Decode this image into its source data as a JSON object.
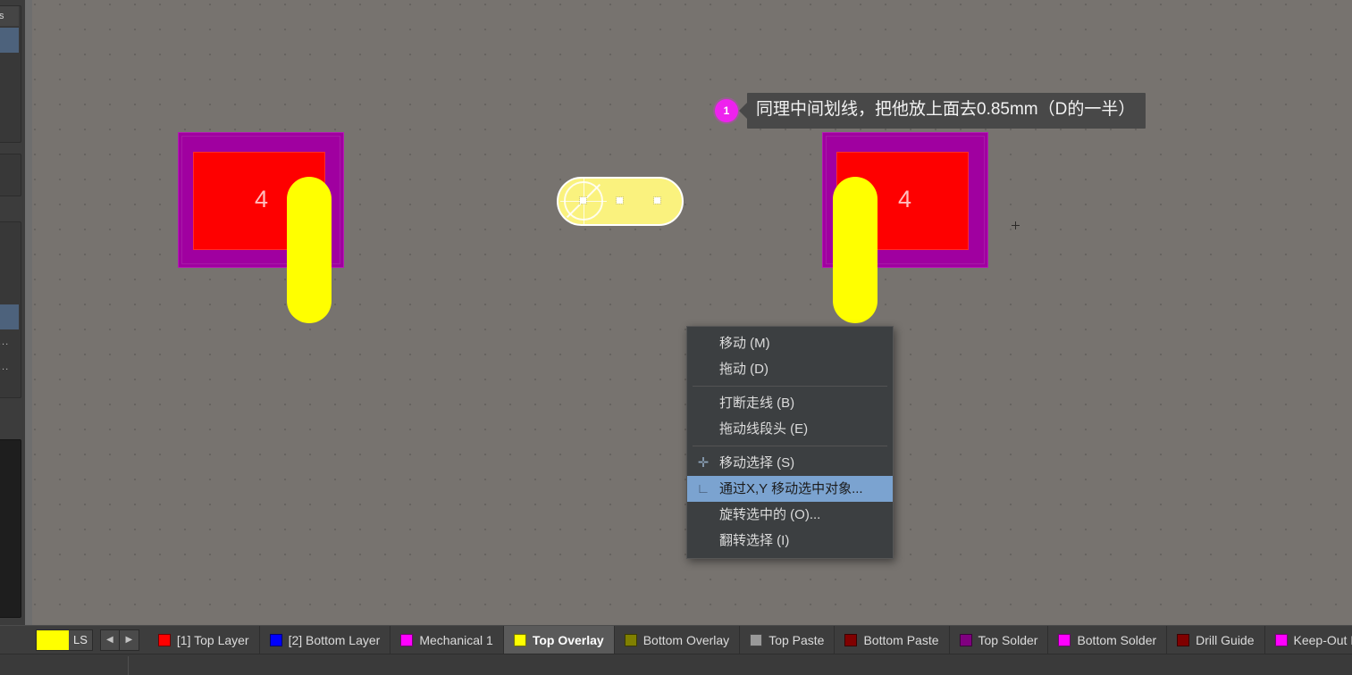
{
  "canvas": {
    "background_color": "#77736f",
    "grid_spacing_px": 28,
    "footprints": [
      {
        "id": "left-footprint",
        "pad_number": "4",
        "mask_color": "#a000a0",
        "pad_color": "#fe0000",
        "silk_color": "#ffff00"
      },
      {
        "id": "right-footprint",
        "pad_number": "4",
        "mask_color": "#a000a0",
        "pad_color": "#fe0000",
        "silk_color": "#ffff00"
      }
    ],
    "selected_track": {
      "name": "selected-overlay-track",
      "fill_color": "#faf27e",
      "outline_color": "#ffffff",
      "handle_count": 3
    }
  },
  "annotation": {
    "badge": "1",
    "badge_color": "#ee22ee",
    "text": "同理中间划线，把他放上面去0.85mm（D的一半）"
  },
  "context_menu": {
    "items": [
      {
        "label": "移动 (M)",
        "icon": "",
        "selected": false,
        "separator_after": true
      },
      {
        "label": "拖动 (D)",
        "icon": "",
        "selected": false,
        "separator_after": true
      },
      {
        "label": "打断走线 (B)",
        "icon": "",
        "selected": false,
        "separator_after": false
      },
      {
        "label": "拖动线段头 (E)",
        "icon": "",
        "selected": false,
        "separator_after": true
      },
      {
        "label": "移动选择 (S)",
        "icon": "plus-icon",
        "selected": false,
        "separator_after": false
      },
      {
        "label": "通过X,Y 移动选中对象...",
        "icon": "axis-icon",
        "selected": true,
        "separator_after": false
      },
      {
        "label": "旋转选中的 (O)...",
        "icon": "",
        "selected": false,
        "separator_after": false
      },
      {
        "label": "翻转选择 (I)",
        "icon": "",
        "selected": false,
        "separator_after": false
      }
    ],
    "highlight_color": "#7ba3d0"
  },
  "layer_bar": {
    "ls_button": {
      "label": "LS",
      "swatch_color": "#ffff00"
    },
    "nav_prev": "◀",
    "nav_next": "▶",
    "tabs": [
      {
        "label": "[1] Top Layer",
        "color": "#ff0000",
        "active": false
      },
      {
        "label": "[2] Bottom Layer",
        "color": "#0000ff",
        "active": false
      },
      {
        "label": "Mechanical 1",
        "color": "#ff00ff",
        "active": false
      },
      {
        "label": "Top Overlay",
        "color": "#ffff00",
        "active": true
      },
      {
        "label": "Bottom Overlay",
        "color": "#808000",
        "active": false
      },
      {
        "label": "Top Paste",
        "color": "#999999",
        "active": false
      },
      {
        "label": "Bottom Paste",
        "color": "#800000",
        "active": false
      },
      {
        "label": "Top Solder",
        "color": "#800080",
        "active": false
      },
      {
        "label": "Bottom Solder",
        "color": "#ff00ff",
        "active": false
      },
      {
        "label": "Drill Guide",
        "color": "#800000",
        "active": false
      },
      {
        "label": "Keep-Out Layer",
        "color": "#ff00ff",
        "active": false
      },
      {
        "label": "",
        "color": "#ff2020",
        "active": false
      }
    ]
  }
}
